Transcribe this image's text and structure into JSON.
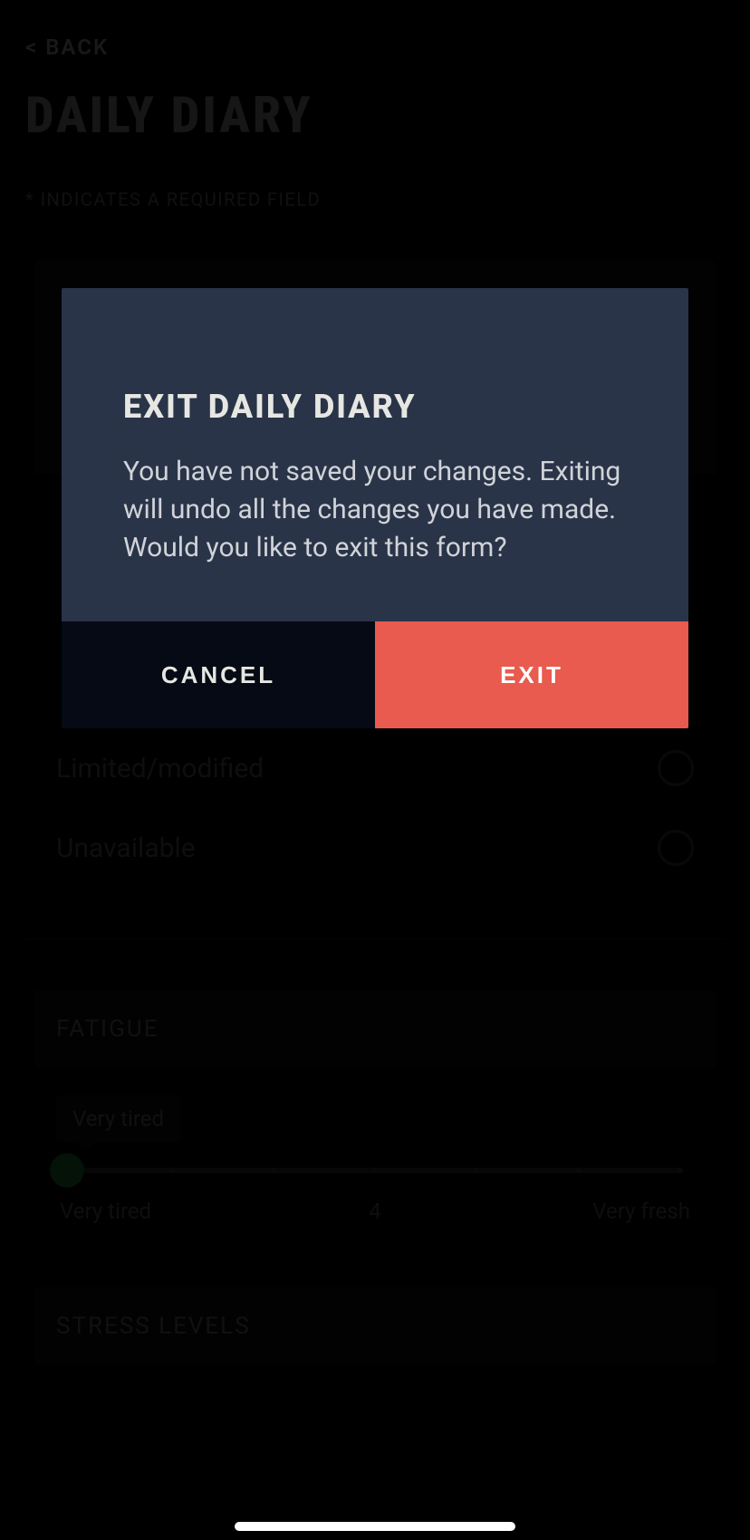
{
  "nav": {
    "back_label": "< BACK"
  },
  "page": {
    "title": "DAILY DIARY",
    "required_note": "* INDICATES A REQUIRED FIELD"
  },
  "availability": {
    "options": [
      {
        "label": "Limited/modified"
      },
      {
        "label": "Unavailable"
      }
    ]
  },
  "fatigue": {
    "header": "FATIGUE",
    "tooltip": "Very tired",
    "left_label": "Very tired",
    "mid_label": "4",
    "right_label": "Very fresh"
  },
  "stress": {
    "header": "STRESS LEVELS"
  },
  "modal": {
    "title": "EXIT DAILY DIARY",
    "message": "You have not saved your changes. Exiting will undo all the changes you have made. Would you like to exit this form?",
    "cancel_label": "CANCEL",
    "exit_label": "EXIT"
  }
}
